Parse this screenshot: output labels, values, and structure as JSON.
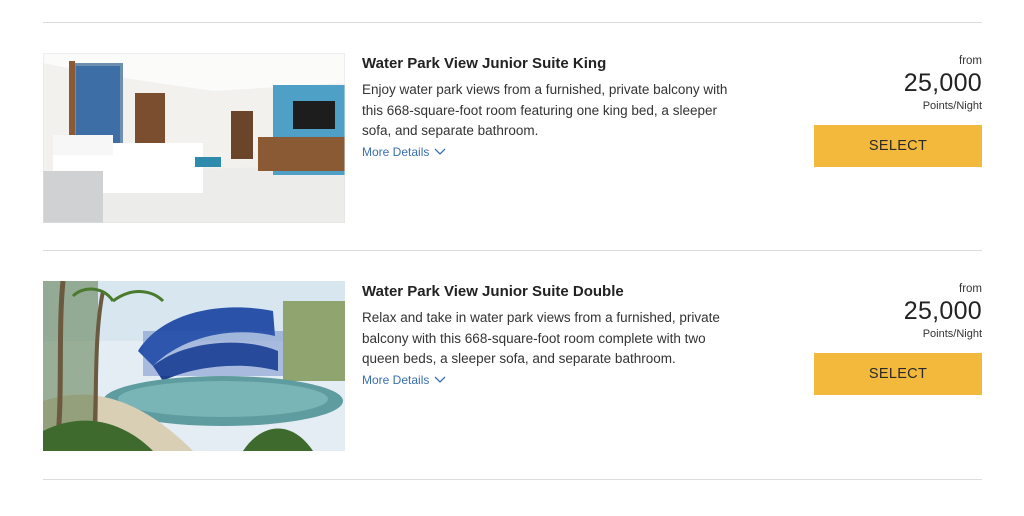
{
  "rooms": [
    {
      "title": "Water Park View Junior Suite King",
      "description": "Enjoy water park views from a furnished, private balcony with this 668-square-foot room featuring one king bed, a sleeper sofa, and separate bathroom.",
      "more_details_label": "More Details",
      "from_label": "from",
      "points": "25,000",
      "points_unit": "Points/Night",
      "select_label": "SELECT",
      "image_icon": "hotel-room-photo"
    },
    {
      "title": "Water Park View Junior Suite Double",
      "description": "Relax and take in water park views from a furnished, private balcony with this 668-square-foot room complete with two queen beds, a sleeper sofa, and separate bathroom.",
      "more_details_label": "More Details",
      "from_label": "from",
      "points": "25,000",
      "points_unit": "Points/Night",
      "select_label": "SELECT",
      "image_icon": "water-park-photo"
    }
  ],
  "colors": {
    "select_button": "#f3b93d",
    "link": "#3a6fb0",
    "divider": "#dcdcdc"
  }
}
